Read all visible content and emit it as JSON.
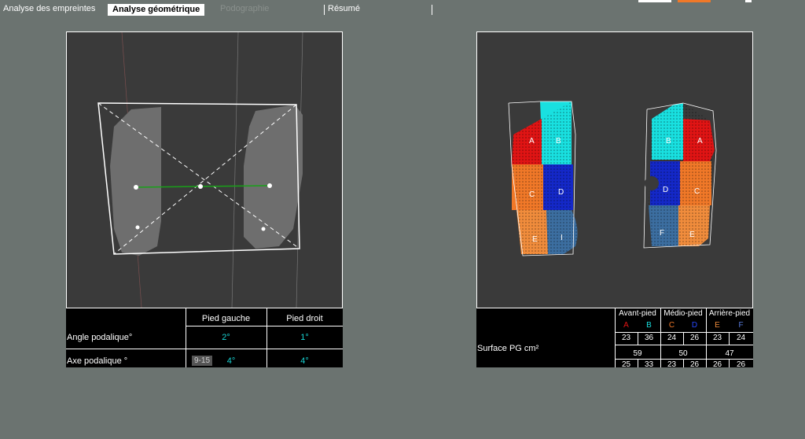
{
  "tabs": [
    {
      "label": "Analyse des empreintes"
    },
    {
      "label": "Analyse géométrique"
    },
    {
      "label": "Podographie"
    },
    {
      "label": "Résumé"
    }
  ],
  "colors": {
    "background": "#6b7370",
    "canvas": "#3a3a3a",
    "value_cyan": "#19d4d4",
    "zone_A": "#e01414",
    "zone_B": "#19e0e0",
    "zone_C": "#f07828",
    "zone_D": "#1428c8",
    "zone_E": "#f08c3c",
    "zone_F": "#3c6ea0"
  },
  "left_table": {
    "col_headers": [
      "Pied gauche",
      "Pied droit"
    ],
    "rows": [
      {
        "label": "Angle podalique°",
        "badge": "",
        "left": "2°",
        "right": "1°"
      },
      {
        "label": "Axe podalique °",
        "badge": "9-15",
        "left": "4°",
        "right": "4°"
      }
    ]
  },
  "footprints": {
    "left_foot_zones": [
      "A",
      "B",
      "C",
      "D",
      "E",
      "I"
    ],
    "right_foot_zones": [
      "B",
      "A",
      "D",
      "C",
      "F",
      "E"
    ]
  },
  "right_table": {
    "groups": [
      "Avant-pied",
      "Médio-pied",
      "Arrière-pied"
    ],
    "zones": [
      "A",
      "B",
      "C",
      "D",
      "E",
      "F"
    ],
    "row_label": "Surface PG cm²",
    "values_top": [
      "23",
      "36",
      "24",
      "26",
      "23",
      "24"
    ],
    "group_totals": [
      "59",
      "50",
      "47"
    ],
    "values_bottom": [
      "25",
      "33",
      "23",
      "26",
      "26",
      "26"
    ]
  }
}
